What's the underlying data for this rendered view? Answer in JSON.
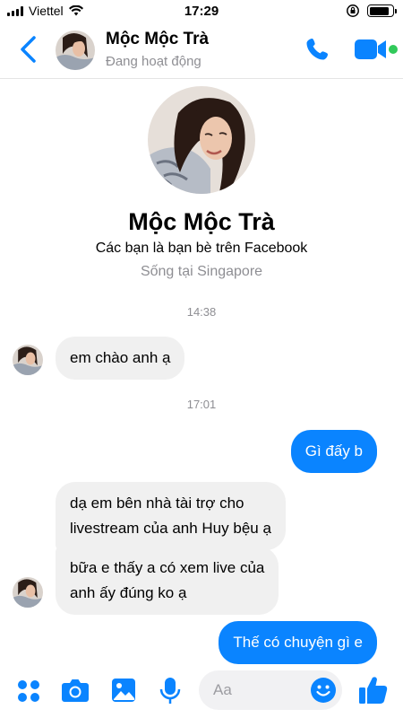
{
  "status_bar": {
    "carrier": "Viettel",
    "time": "17:29",
    "battery_level": 0.85,
    "icons": [
      "signal-icon",
      "wifi-icon",
      "rotation-lock-icon",
      "battery-icon"
    ]
  },
  "header": {
    "name": "Mộc Mộc Trà",
    "status": "Đang hoạt động",
    "icons": [
      "back-chevron-icon",
      "phone-icon",
      "video-camera-icon"
    ],
    "accent": "#0a84ff",
    "online_color": "#31c95a"
  },
  "profile": {
    "name": "Mộc Mộc Trà",
    "info": "Các bạn là bạn bè trên Facebook",
    "location": "Sống tại Singapore"
  },
  "conversation": {
    "timestamps": [
      "14:38",
      "17:01"
    ],
    "messages": [
      {
        "from": "them",
        "text": "em chào anh ạ"
      },
      {
        "from": "me",
        "text": "Gì đấy b"
      },
      {
        "from": "them",
        "lines": [
          "dạ em bên nhà tài trợ cho",
          "livestream của anh Huy bệu ạ"
        ]
      },
      {
        "from": "them",
        "lines": [
          "bữa e thấy a có xem live của",
          "anh ấy đúng ko ạ"
        ]
      },
      {
        "from": "me",
        "text": "Thế có chuyện gì e"
      }
    ]
  },
  "composer": {
    "placeholder": "Aa",
    "icons": [
      "menu-dots-icon",
      "camera-icon",
      "photo-icon",
      "microphone-icon",
      "emoji-icon",
      "thumbs-up-icon"
    ]
  }
}
